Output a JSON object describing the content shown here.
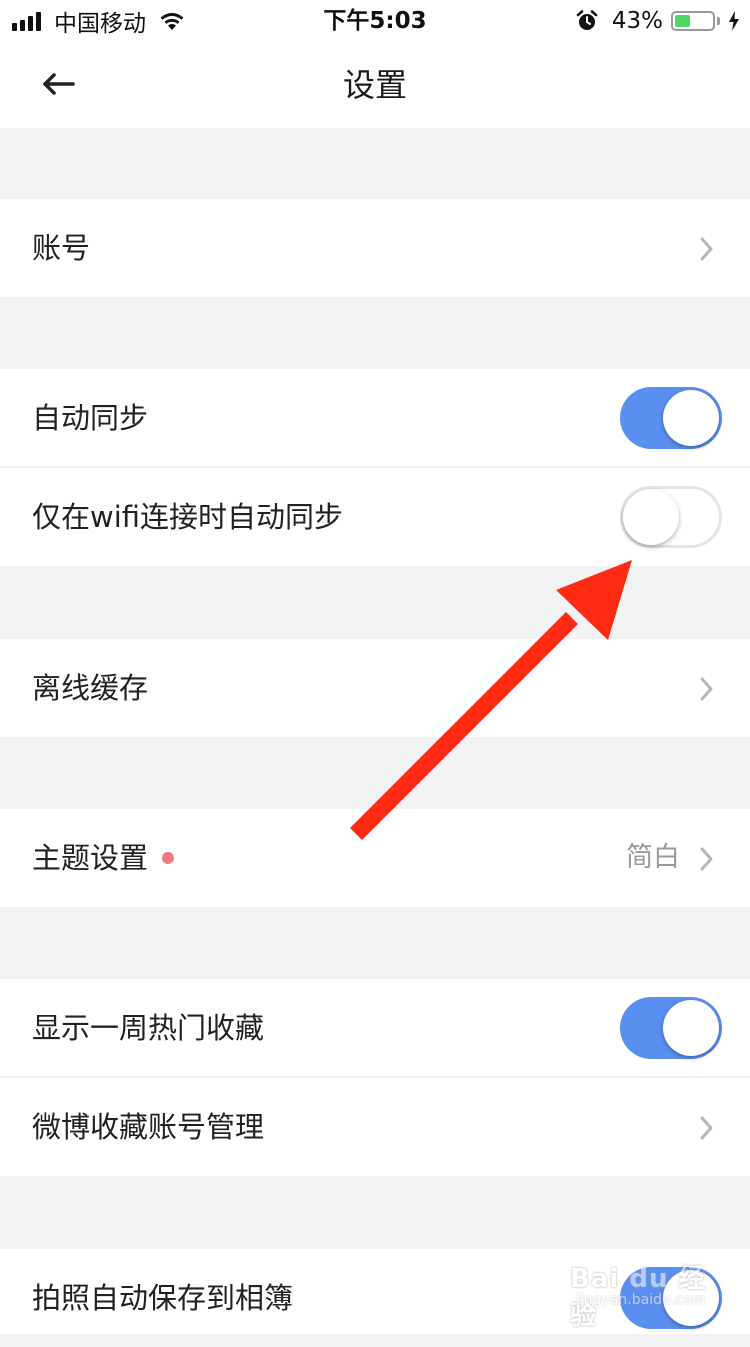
{
  "status_bar": {
    "carrier": "中国移动",
    "time": "下午5:03",
    "battery_percent": "43%",
    "battery_level": 0.43,
    "icons": [
      "signal-icon",
      "wifi-icon",
      "alarm-icon",
      "battery-icon",
      "charging-icon"
    ]
  },
  "nav": {
    "title": "设置",
    "back_icon": "back-arrow-icon"
  },
  "settings": {
    "account": "账号",
    "auto_sync": "自动同步",
    "auto_sync_on": true,
    "wifi_only_sync": "仅在wifi连接时自动同步",
    "wifi_only_sync_on": false,
    "offline_cache": "离线缓存",
    "theme": "主题设置",
    "theme_value": "简白",
    "weekly_hot": "显示一周热门收藏",
    "weekly_hot_on": true,
    "weibo_accounts": "微博收藏账号管理",
    "save_photos": "拍照自动保存到相簿",
    "save_photos_on": true
  },
  "colors": {
    "toggle_on": "#5a8ff2",
    "annotation_arrow": "#ff2a12",
    "theme_dot": "#f07a7f",
    "background": "#f2f2f4"
  },
  "watermark": {
    "brand": "Bai du 经验",
    "url": "jingyan.baidu.com"
  }
}
